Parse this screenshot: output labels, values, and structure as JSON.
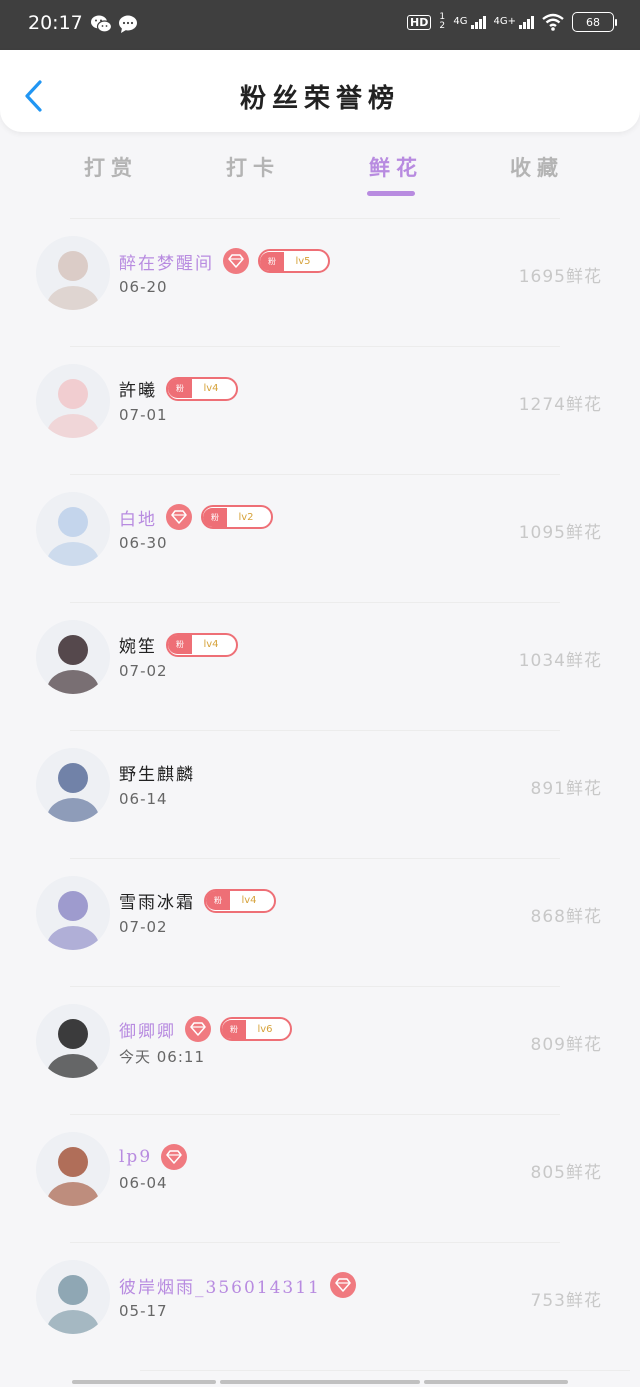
{
  "status_bar": {
    "time": "20:17",
    "hd_label": "HD",
    "hd_sub": "1 2",
    "net1_label": "4G",
    "net2_label": "4G+",
    "battery": "68"
  },
  "header": {
    "title": "粉丝荣誉榜",
    "back_icon": "chevron-left-icon"
  },
  "tabs": [
    {
      "label": "打赏",
      "active": false
    },
    {
      "label": "打卡",
      "active": false
    },
    {
      "label": "鲜花",
      "active": true
    },
    {
      "label": "收藏",
      "active": false
    }
  ],
  "fans": [
    {
      "name": "醉在梦醒间",
      "vip": true,
      "diamond": true,
      "level": "lv5",
      "fan_tag": "粉",
      "date": "06-20",
      "score": "1695鲜花",
      "avatar_color": "#d7c6be"
    },
    {
      "name": "許曦",
      "vip": false,
      "diamond": false,
      "level": "lv4",
      "fan_tag": "粉",
      "date": "07-01",
      "score": "1274鲜花",
      "avatar_color": "#f1c7c9"
    },
    {
      "name": "白地",
      "vip": true,
      "diamond": true,
      "level": "lv2",
      "fan_tag": "粉",
      "date": "06-30",
      "score": "1095鲜花",
      "avatar_color": "#bcd0ea"
    },
    {
      "name": "婉笙",
      "vip": false,
      "diamond": false,
      "level": "lv4",
      "fan_tag": "粉",
      "date": "07-02",
      "score": "1034鲜花",
      "avatar_color": "#3a2a2e"
    },
    {
      "name": "野生麒麟",
      "vip": false,
      "diamond": false,
      "level": null,
      "fan_tag": null,
      "date": "06-14",
      "score": "891鲜花",
      "avatar_color": "#5a6f9a"
    },
    {
      "name": "雪雨冰霜",
      "vip": false,
      "diamond": false,
      "level": "lv4",
      "fan_tag": "粉",
      "date": "07-02",
      "score": "868鲜花",
      "avatar_color": "#8f8cc7"
    },
    {
      "name": "御卿卿",
      "vip": true,
      "diamond": true,
      "level": "lv6",
      "fan_tag": "粉",
      "date": "今天 06:11",
      "score": "809鲜花",
      "avatar_color": "#1b1b1b"
    },
    {
      "name": "lp9",
      "vip": true,
      "diamond": true,
      "level": null,
      "fan_tag": null,
      "date": "06-04",
      "score": "805鲜花",
      "avatar_color": "#a5573d"
    },
    {
      "name": "彼岸烟雨_356014311",
      "vip": true,
      "diamond": true,
      "level": null,
      "fan_tag": null,
      "date": "05-17",
      "score": "753鲜花",
      "avatar_color": "#7e9aa8"
    }
  ],
  "colors": {
    "accent": "#b88be0",
    "badge": "#ee6f76",
    "score": "#c8c8c8",
    "back": "#2196f3"
  }
}
